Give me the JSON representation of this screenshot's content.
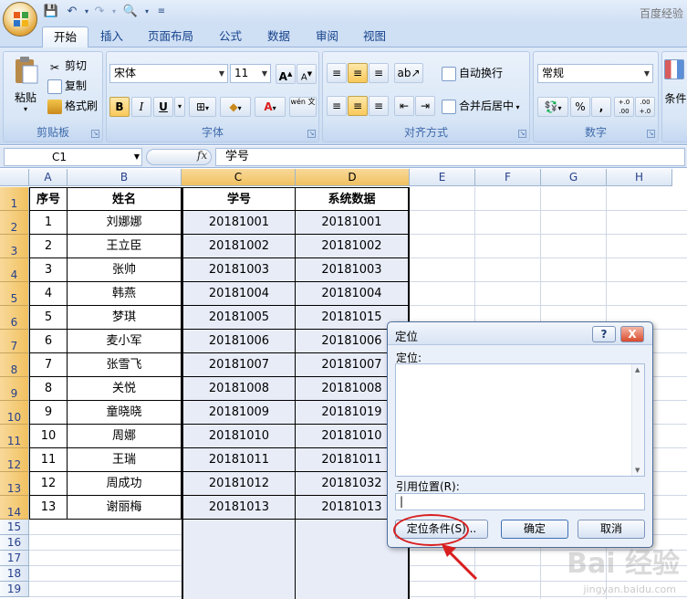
{
  "title_bar": {
    "app_title": "百度经验"
  },
  "tabs": [
    "开始",
    "插入",
    "页面布局",
    "公式",
    "数据",
    "审阅",
    "视图"
  ],
  "ribbon": {
    "clipboard": {
      "paste": "粘贴",
      "cut": "剪切",
      "copy": "复制",
      "format_painter": "格式刷",
      "label": "剪贴板"
    },
    "font": {
      "font_name": "宋体",
      "font_size": "11",
      "bold": "B",
      "italic": "I",
      "underline": "U",
      "label": "字体",
      "grow": "A",
      "shrink": "A",
      "font_color_glyph": "A",
      "wen_glyph": "wén 文"
    },
    "alignment": {
      "wrap_text": "自动换行",
      "merge_center": "合并后居中",
      "label": "对齐方式"
    },
    "number": {
      "format": "常规",
      "percent": "%",
      "comma": ",",
      "inc_decimal": "+.0 .00",
      "dec_decimal": ".00 +.0",
      "label": "数字"
    },
    "styles": {
      "conditional": "条件"
    }
  },
  "formula_bar": {
    "name_box": "C1",
    "fx": "fx",
    "content": "学号"
  },
  "columns": [
    "A",
    "B",
    "C",
    "D",
    "E",
    "F",
    "G",
    "H"
  ],
  "rows": [
    "1",
    "2",
    "3",
    "4",
    "5",
    "6",
    "7",
    "8",
    "9",
    "10",
    "11",
    "12",
    "13",
    "14",
    "15",
    "16",
    "17",
    "18",
    "19"
  ],
  "table": {
    "headers": [
      "序号",
      "姓名",
      "学号",
      "系统数据"
    ],
    "rows": [
      [
        "1",
        "刘娜娜",
        "20181001",
        "20181001"
      ],
      [
        "2",
        "王立臣",
        "20181002",
        "20181002"
      ],
      [
        "3",
        "张帅",
        "20181003",
        "20181003"
      ],
      [
        "4",
        "韩燕",
        "20181004",
        "20181004"
      ],
      [
        "5",
        "梦琪",
        "20181005",
        "20181015"
      ],
      [
        "6",
        "麦小军",
        "20181006",
        "20181006"
      ],
      [
        "7",
        "张雪飞",
        "20181007",
        "20181007"
      ],
      [
        "8",
        "关悦",
        "20181008",
        "20181008"
      ],
      [
        "9",
        "童晓晓",
        "20181009",
        "20181019"
      ],
      [
        "10",
        "周娜",
        "20181010",
        "20181010"
      ],
      [
        "11",
        "王瑞",
        "20181011",
        "20181011"
      ],
      [
        "12",
        "周成功",
        "20181012",
        "20181032"
      ],
      [
        "13",
        "谢丽梅",
        "20181013",
        "20181013"
      ]
    ]
  },
  "dialog": {
    "title": "定位",
    "help": "?",
    "close": "X",
    "goto_label": "定位:",
    "reference_label": "引用位置(R):",
    "reference_value": "|",
    "special_button": "定位条件(S)...",
    "ok_button": "确定",
    "cancel_button": "取消"
  },
  "watermark": {
    "brand": "Bai 经验",
    "url": "jingyan.baidu.com"
  },
  "colors": {
    "selected_header": "#f1c15f",
    "selection_fill": "#e8ecf7",
    "annotation_red": "#d81e1e"
  }
}
